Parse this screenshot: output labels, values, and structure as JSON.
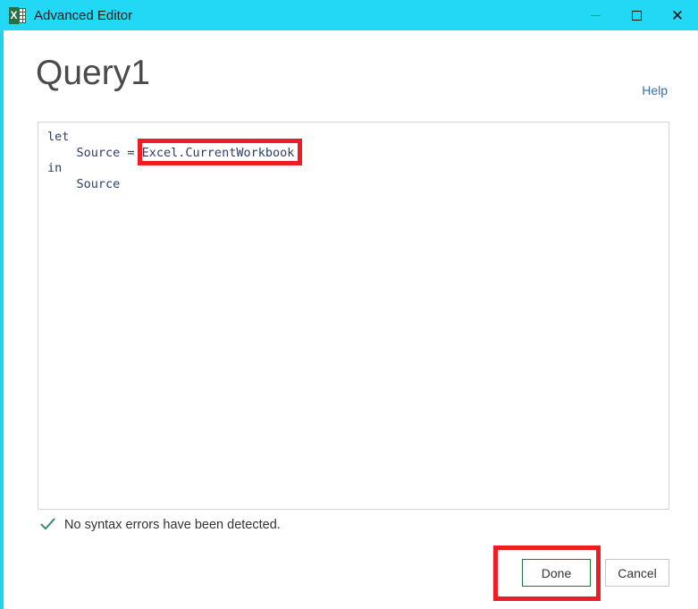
{
  "window": {
    "titlebar": {
      "app_icon": "excel-icon",
      "title": "Advanced Editor",
      "background_color": "#22d8f5",
      "controls": {
        "minimize": "–",
        "maximize": "□",
        "close": "✕"
      }
    }
  },
  "header": {
    "query_name": "Query1",
    "help_label": "Help"
  },
  "editor": {
    "code": "let\n    Source = Excel.CurrentWorkbook\nin\n    Source",
    "lines": [
      "let",
      "    Source = Excel.CurrentWorkbook",
      "in",
      "    Source"
    ],
    "text_color": "#2c3e63"
  },
  "annotations": {
    "highlight_color": "#ee1c23",
    "items": [
      {
        "name": "code-expression-highlight",
        "target": "Excel.CurrentWorkbook"
      },
      {
        "name": "done-button-highlight",
        "target": "Done"
      }
    ]
  },
  "status": {
    "icon": "check-icon",
    "icon_color": "#3d8f72",
    "message": "No syntax errors have been detected."
  },
  "footer": {
    "done_label": "Done",
    "done_border_color": "#217346",
    "cancel_label": "Cancel",
    "cancel_border_color": "#c6c6c6"
  }
}
